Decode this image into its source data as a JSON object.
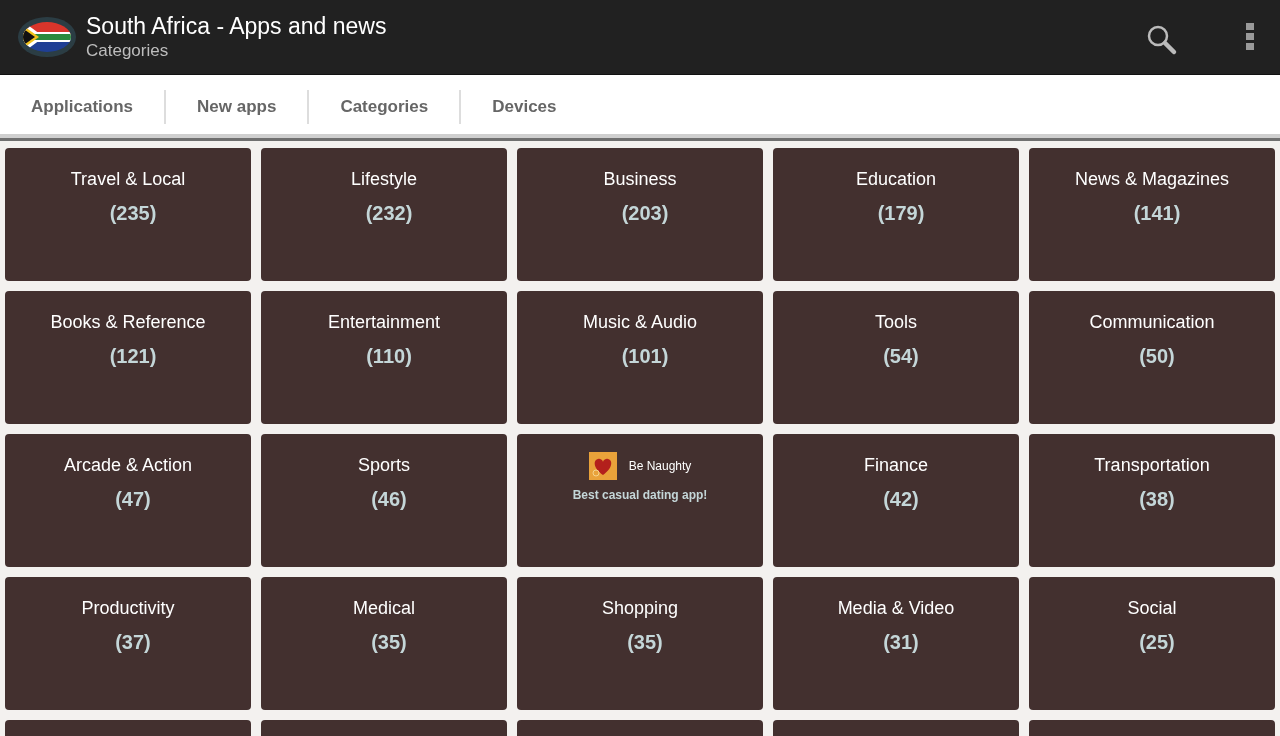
{
  "app_bar": {
    "title": "South Africa - Apps and news",
    "subtitle": "Categories"
  },
  "tabs": [
    "Applications",
    "New apps",
    "Categories",
    "Devices"
  ],
  "tiles": [
    {
      "kind": "category",
      "name": "Travel & Local",
      "count": "(235)"
    },
    {
      "kind": "category",
      "name": "Lifestyle",
      "count": "(232)"
    },
    {
      "kind": "category",
      "name": "Business",
      "count": "(203)"
    },
    {
      "kind": "category",
      "name": "Education",
      "count": "(179)"
    },
    {
      "kind": "category",
      "name": "News & Magazines",
      "count": "(141)"
    },
    {
      "kind": "category",
      "name": "Books & Reference",
      "count": "(121)"
    },
    {
      "kind": "category",
      "name": "Entertainment",
      "count": "(110)"
    },
    {
      "kind": "category",
      "name": "Music & Audio",
      "count": "(101)"
    },
    {
      "kind": "category",
      "name": "Tools",
      "count": "(54)"
    },
    {
      "kind": "category",
      "name": "Communication",
      "count": "(50)"
    },
    {
      "kind": "category",
      "name": "Arcade & Action",
      "count": "(47)"
    },
    {
      "kind": "category",
      "name": "Sports",
      "count": "(46)"
    },
    {
      "kind": "ad",
      "name": "Be Naughty",
      "tagline": "Best casual dating app!"
    },
    {
      "kind": "category",
      "name": "Finance",
      "count": "(42)"
    },
    {
      "kind": "category",
      "name": "Transportation",
      "count": "(38)"
    },
    {
      "kind": "category",
      "name": "Productivity",
      "count": "(37)"
    },
    {
      "kind": "category",
      "name": "Medical",
      "count": "(35)"
    },
    {
      "kind": "category",
      "name": "Shopping",
      "count": "(35)"
    },
    {
      "kind": "category",
      "name": "Media & Video",
      "count": "(31)"
    },
    {
      "kind": "category",
      "name": "Social",
      "count": "(25)"
    },
    {
      "kind": "blank"
    },
    {
      "kind": "blank"
    },
    {
      "kind": "blank"
    },
    {
      "kind": "blank"
    },
    {
      "kind": "blank"
    }
  ]
}
